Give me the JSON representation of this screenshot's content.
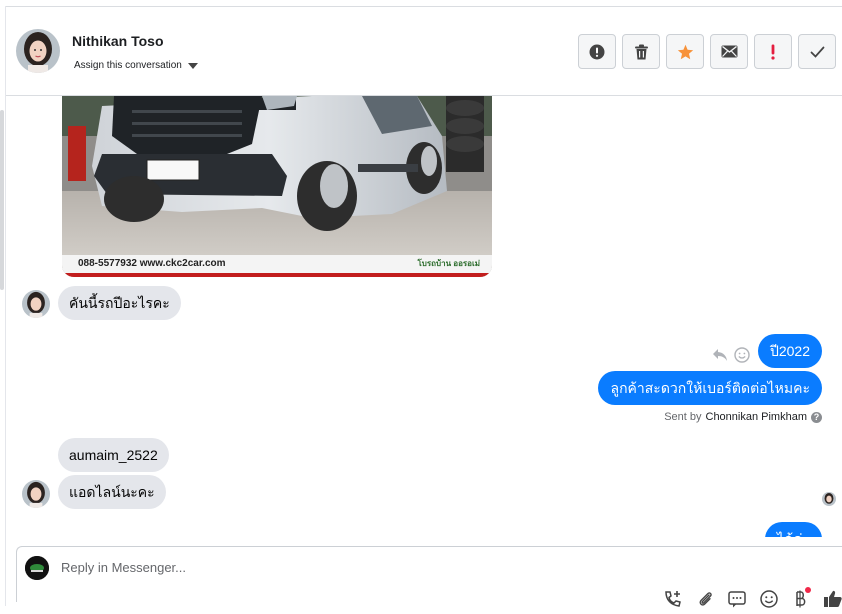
{
  "header": {
    "contact_name": "Nithikan Toso",
    "assign_label": "Assign this conversation",
    "actions": [
      {
        "icon": "alert-circle-icon",
        "label": "Spam"
      },
      {
        "icon": "trash-icon",
        "label": "Delete"
      },
      {
        "icon": "star-icon",
        "label": "Star"
      },
      {
        "icon": "envelope-icon",
        "label": "Mark unread"
      },
      {
        "icon": "exclamation-icon",
        "label": "Follow up"
      },
      {
        "icon": "check-icon",
        "label": "Done"
      }
    ]
  },
  "conversation": {
    "image_caption": "088-5577932 www.ckc2car.com",
    "image_logo_text": "โบรถบ้าน ออรอเม่",
    "messages": [
      {
        "direction": "in",
        "text": "คันนี้รถปีอะไรคะ"
      },
      {
        "direction": "out",
        "text": "ปี2022"
      },
      {
        "direction": "out",
        "text": "ลูกค้าสะดวกให้เบอร์ติดต่อไหมคะ"
      },
      {
        "direction": "in",
        "text": "aumaim_2522"
      },
      {
        "direction": "in",
        "text": "แอดไลน์นะคะ"
      },
      {
        "direction": "out",
        "text": "ได้ค่ะ"
      }
    ],
    "sent_by_prefix": "Sent by",
    "sent_by_name": "Chonnikan Pimkham",
    "help_glyph": "?"
  },
  "composer": {
    "placeholder": "Reply in Messenger...",
    "tools": [
      "add-contact-icon",
      "attachment-icon",
      "saved-reply-icon",
      "emoji-icon",
      "price-tag-icon",
      "thumbs-up-icon"
    ]
  },
  "colors": {
    "accent": "#0a7cff",
    "star": "#f7923a",
    "alert_red": "#e41e3f",
    "incoming_bubble": "#e4e6eb"
  }
}
